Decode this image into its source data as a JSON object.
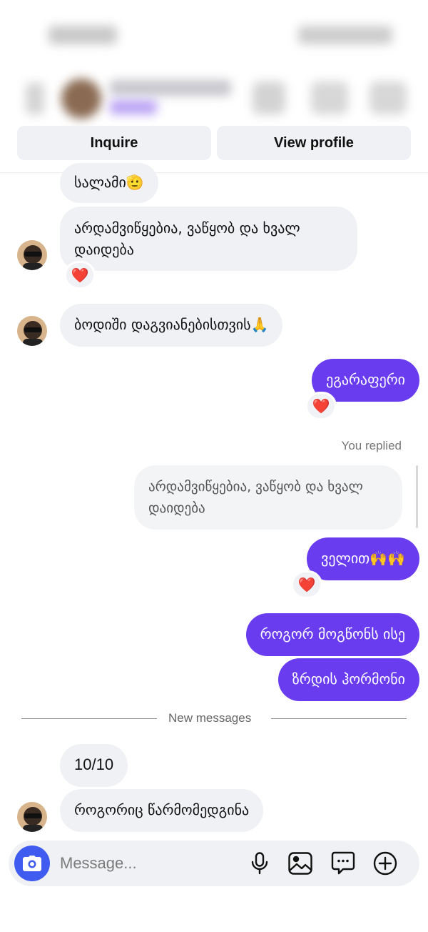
{
  "header": {
    "actions": {
      "inquire_label": "Inquire",
      "view_profile_label": "View profile"
    }
  },
  "messages": [
    {
      "id": "m1",
      "direction": "incoming",
      "text": "სალამი🫡"
    },
    {
      "id": "m2",
      "direction": "incoming",
      "text_line1": "არდამვიწყებია, ვაწყობ და ხვალ",
      "text_line2": "დაიდება",
      "reaction": "❤️"
    },
    {
      "id": "m3",
      "direction": "incoming",
      "text": "ბოდიში დაგვიანებისთვის🙏"
    },
    {
      "id": "m4",
      "direction": "outgoing",
      "text": "ეგარაფერი",
      "reaction": "❤️"
    },
    {
      "id": "m5",
      "direction": "outgoing",
      "replied_label": "You replied",
      "quoted_line1": "არდამვიწყებია, ვაწყობ და ხვალ",
      "quoted_line2": "დაიდება"
    },
    {
      "id": "m6",
      "direction": "outgoing",
      "text": "ველით🙌🙌",
      "reaction": "❤️"
    },
    {
      "id": "m7",
      "direction": "outgoing",
      "text": "როგორ მოგწონს ისე"
    },
    {
      "id": "m8",
      "direction": "outgoing",
      "text": "ზრდის ჰორმონი"
    },
    {
      "id": "m9",
      "direction": "incoming",
      "text": "10/10"
    },
    {
      "id": "m10",
      "direction": "incoming",
      "text": "როგორიც წარმომედგინა"
    }
  ],
  "new_messages_label": "New messages",
  "composer": {
    "placeholder": "Message...",
    "icons": [
      "camera-icon",
      "microphone-icon",
      "gallery-icon",
      "sticker-icon",
      "plus-icon"
    ]
  },
  "colors": {
    "outgoing_bubble": "#6a3cf0",
    "incoming_bubble": "#eff1f4",
    "camera_button": "#3f5bf0"
  }
}
